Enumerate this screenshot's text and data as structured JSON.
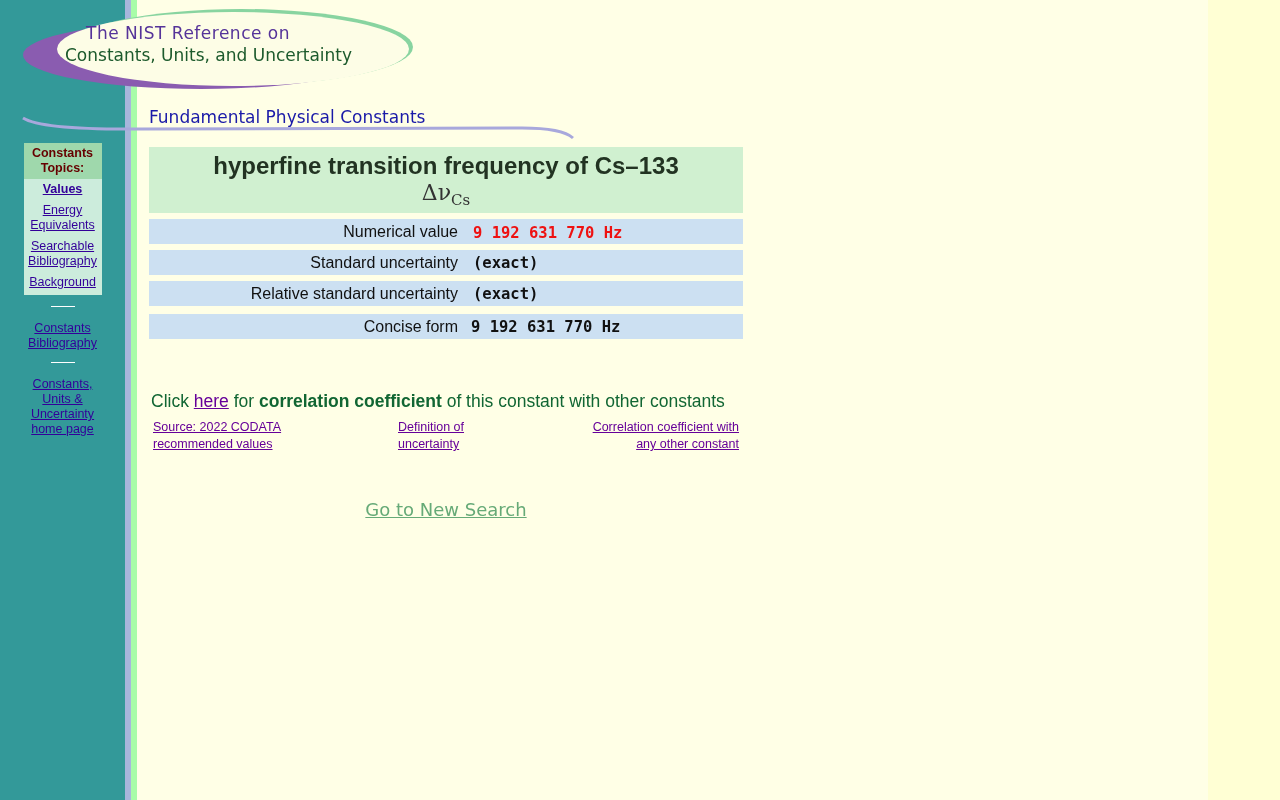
{
  "header": {
    "logo_line_1": "The NIST Reference on",
    "logo_line_2": "Constants, Units, and Uncertainty",
    "section_title": "Fundamental Physical Constants"
  },
  "sidebar": {
    "topics_heading": "Constants Topics:",
    "topics": [
      {
        "label": "Values",
        "selected": true
      },
      {
        "label": "Energy Equivalents",
        "selected": false
      },
      {
        "label": "Searchable Bibliography",
        "selected": false
      },
      {
        "label": "Background",
        "selected": false
      }
    ],
    "links": [
      "Constants Bibliography",
      "Constants, Units & Uncertainty home page"
    ]
  },
  "constant": {
    "name": "hyperfine transition frequency of Cs–133",
    "symbol": "Δν$_{Cs}$",
    "rows": [
      {
        "label": "Numerical value",
        "value": "9 192 631 770 Hz",
        "kind": "highlight"
      },
      {
        "label": "Standard uncertainty",
        "value": "(exact)",
        "kind": "plain"
      },
      {
        "label": "Relative standard uncertainty",
        "value": "(exact)",
        "kind": "plain"
      },
      {
        "label": "Concise form",
        "value": "9 192 631 770 Hz",
        "kind": "concise"
      }
    ]
  },
  "correlation_note": {
    "before": "Click ",
    "link": "here",
    "after": " for **correlation coefficient** of this constant with other constants"
  },
  "footer_links": [
    "Source: 2022 CODATA recommended values",
    "Definition of uncertainty",
    "Correlation coefficient with any other constant"
  ],
  "new_search": "Go to New Search"
}
